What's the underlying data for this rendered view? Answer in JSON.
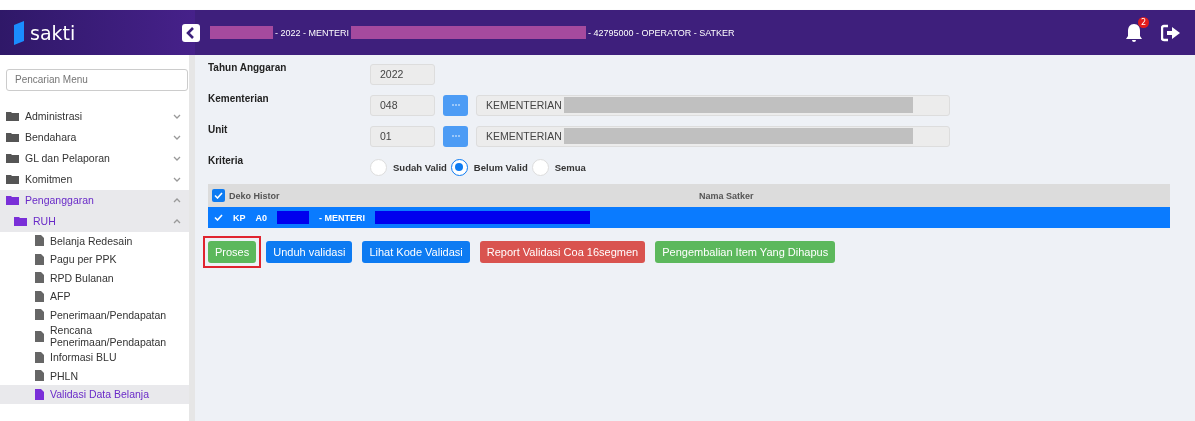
{
  "header": {
    "logo": "sakti",
    "context": [
      {
        "kind": "redacted"
      },
      {
        "kind": "text",
        "text": "- 2022 - MENTERI"
      },
      {
        "kind": "redacted"
      },
      {
        "kind": "text",
        "text": "- 42795000 - OPERATOR - SATKER"
      }
    ],
    "notification_count": "2"
  },
  "sidebar": {
    "search": {
      "placeholder": "Pencarian Menu"
    },
    "items": [
      {
        "label": "Administrasi",
        "expanded": false,
        "selected": false
      },
      {
        "label": "Bendahara",
        "expanded": false,
        "selected": false
      },
      {
        "label": "GL dan Pelaporan",
        "expanded": false,
        "selected": false
      },
      {
        "label": "Komitmen",
        "expanded": false,
        "selected": false
      },
      {
        "label": "Penganggaran",
        "expanded": true,
        "selected": true,
        "children": [
          {
            "label": "RUH",
            "expanded": true,
            "selected": true,
            "children": [
              {
                "label": "Belanja Redesain",
                "selected": false
              },
              {
                "label": "Pagu per PPK",
                "selected": false
              },
              {
                "label": "RPD Bulanan",
                "selected": false
              },
              {
                "label": "AFP",
                "selected": false
              },
              {
                "label": "Penerimaan/Pendapatan",
                "selected": false
              },
              {
                "label": "Rencana Penerimaan/Pendapatan",
                "selected": false
              },
              {
                "label": "Informasi BLU",
                "selected": false
              },
              {
                "label": "PHLN",
                "selected": false
              },
              {
                "label": "Validasi Data Belanja",
                "selected": true
              }
            ]
          }
        ]
      }
    ]
  },
  "form": {
    "tahun": {
      "label": "Tahun Anggaran",
      "value": "2022"
    },
    "kementerian": {
      "label": "Kementerian",
      "code": "048",
      "name": "KEMENTERIAN"
    },
    "unit": {
      "label": "Unit",
      "code": "01",
      "name": "KEMENTERIAN"
    },
    "kriteria": {
      "label": "Kriteria",
      "options": [
        {
          "label": "Sudah Valid",
          "selected": false
        },
        {
          "label": "Belum Valid",
          "selected": true
        },
        {
          "label": "Semua",
          "selected": false
        }
      ]
    }
  },
  "table": {
    "header": {
      "checked": true,
      "columns": [
        "Deko Histor",
        "Nama Satker"
      ]
    },
    "rows": [
      {
        "checked": true,
        "selected": true,
        "cells": [
          {
            "kind": "text",
            "text": "KP"
          },
          {
            "kind": "text",
            "text": "A0"
          },
          {
            "kind": "redacted"
          },
          {
            "kind": "text",
            "text": "- MENTERI"
          },
          {
            "kind": "redacted"
          }
        ]
      }
    ]
  },
  "buttons": [
    {
      "label": "Proses",
      "kind": "success",
      "highlighted": true
    },
    {
      "label": "Unduh validasi",
      "kind": "primary",
      "highlighted": false
    },
    {
      "label": "Lihat Kode Validasi",
      "kind": "primary",
      "highlighted": false
    },
    {
      "label": "Report Validasi Coa 16segmen",
      "kind": "danger",
      "highlighted": false
    },
    {
      "label": "Pengembalian Item Yang Dihapus",
      "kind": "success",
      "highlighted": false
    }
  ]
}
